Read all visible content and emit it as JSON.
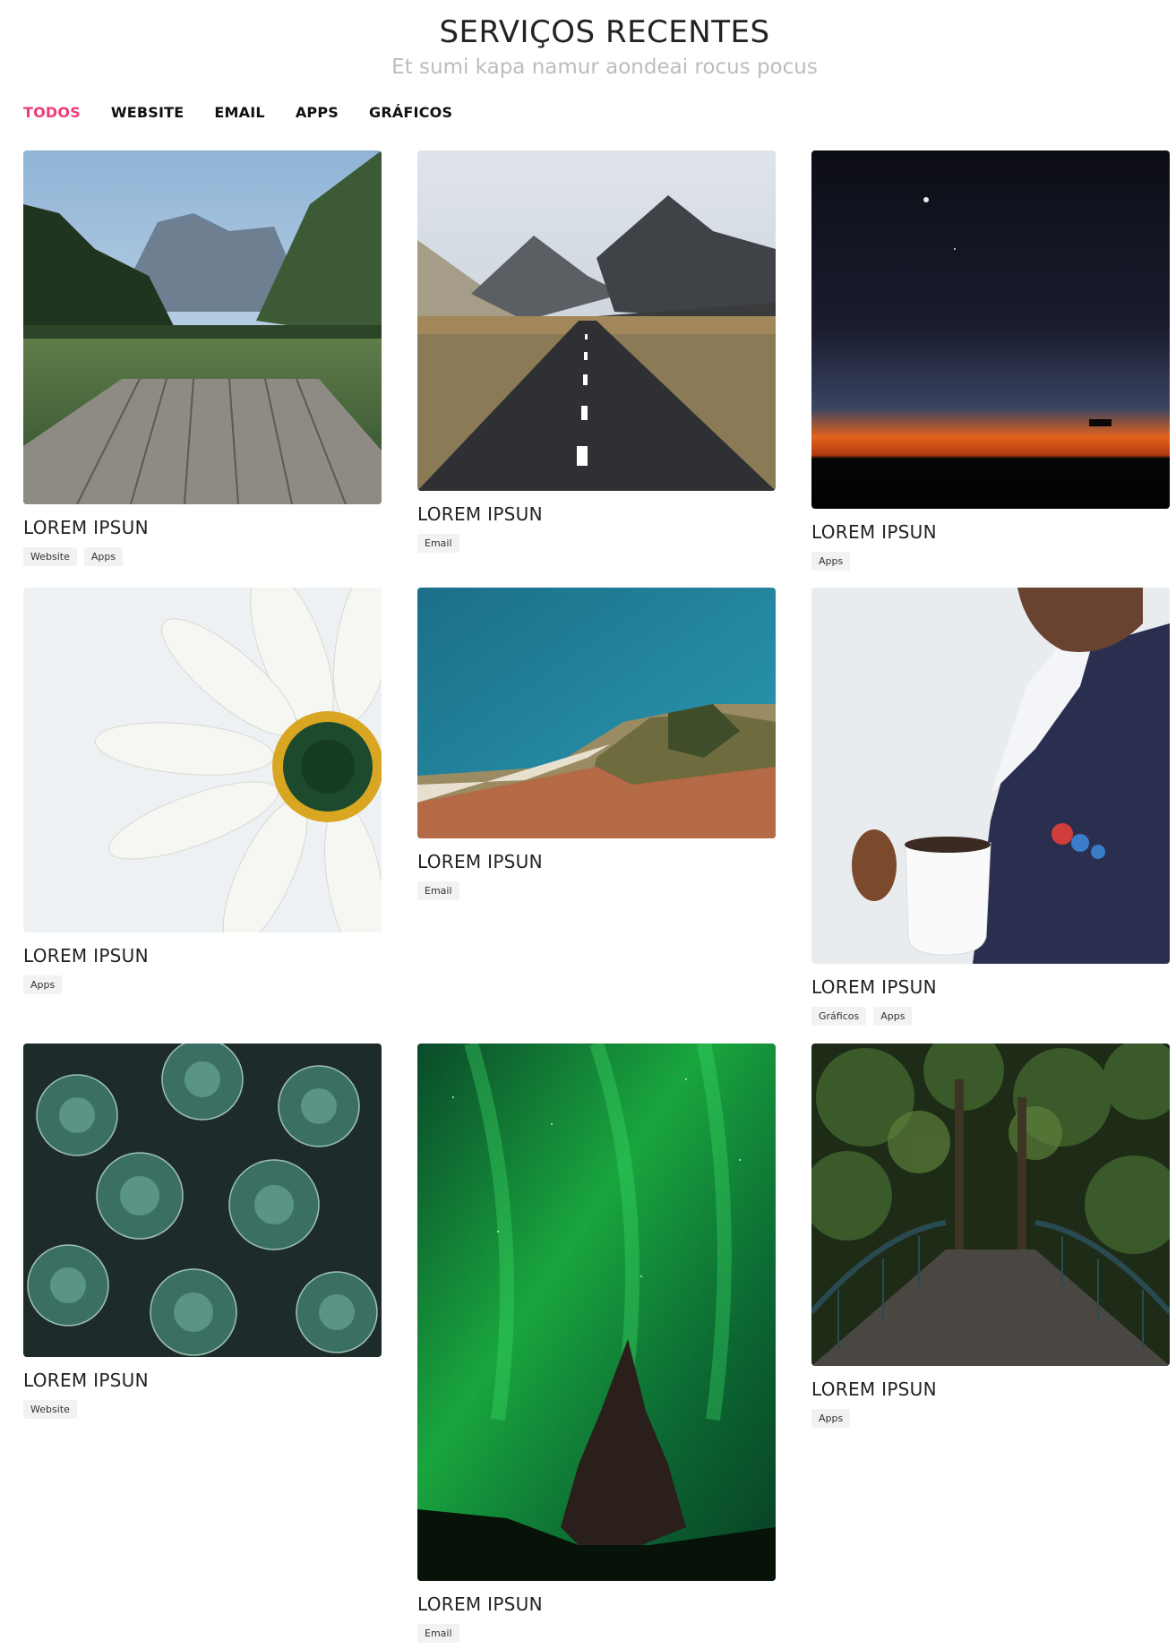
{
  "header": {
    "title": "SERVIÇOS RECENTES",
    "subtitle": "Et sumi kapa namur aondeai rocus pocus"
  },
  "filters": [
    "TODOS",
    "WEBSITE",
    "EMAIL",
    "APPS",
    "GRÁFICOS"
  ],
  "accent_color": "#ee3c78",
  "cards": [
    {
      "title": "LOREM IPSUN",
      "tags": [
        "Website",
        "Apps"
      ]
    },
    {
      "title": "LOREM IPSUN",
      "tags": [
        "Email"
      ]
    },
    {
      "title": "LOREM IPSUN",
      "tags": [
        "Apps"
      ]
    },
    {
      "title": "LOREM IPSUN",
      "tags": [
        "Apps"
      ]
    },
    {
      "title": "LOREM IPSUN",
      "tags": [
        "Email"
      ]
    },
    {
      "title": "LOREM IPSUN",
      "tags": [
        "Gráficos",
        "Apps"
      ]
    },
    {
      "title": "LOREM IPSUN",
      "tags": [
        "Website"
      ]
    },
    {
      "title": "LOREM IPSUN",
      "tags": [
        "Email"
      ]
    },
    {
      "title": "LOREM IPSUN",
      "tags": [
        "Apps"
      ]
    }
  ]
}
